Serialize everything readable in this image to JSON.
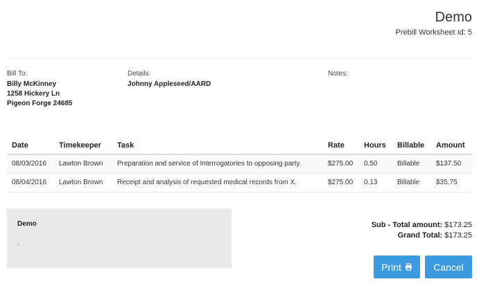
{
  "header": {
    "company": "Demo",
    "worksheet_label": "Prebill Worksheet Id:",
    "worksheet_id": "5"
  },
  "bill_to": {
    "label": "Bill To:",
    "name": "Billy McKinney",
    "address": "1258 Hickery Ln",
    "city": "Pigeon Forge 24685"
  },
  "details": {
    "label": "Details:",
    "value": "Johnny Appleseed/AARD"
  },
  "notes": {
    "label": "Notes:"
  },
  "table": {
    "columns": [
      "Date",
      "Timekeeper",
      "Task",
      "Rate",
      "Hours",
      "Billable",
      "Amount"
    ],
    "rows": [
      [
        "08/03/2016",
        "Lawton Brown",
        "Preparation and service of Interrogatories to opposing party.",
        "$275.00",
        "0.50",
        "Billable",
        "$137.50"
      ],
      [
        "08/04/2016",
        "Lawton Brown",
        "Receipt and analysis of requested medical records from X.",
        "$275.00",
        "0.13",
        "Billable",
        "$35.75"
      ]
    ]
  },
  "notes_box": {
    "title": "Demo",
    "text": ","
  },
  "totals": {
    "subtotal_label": "Sub - Total amount:",
    "subtotal_value": "$173.25",
    "grand_label": "Grand Total:",
    "grand_value": "$173.25"
  },
  "buttons": {
    "print": "Print",
    "cancel": "Cancel"
  },
  "icons": {
    "print": "printer-icon"
  },
  "colors": {
    "button_bg": "#3c9be0",
    "notes_bg": "#e9e9e9"
  }
}
